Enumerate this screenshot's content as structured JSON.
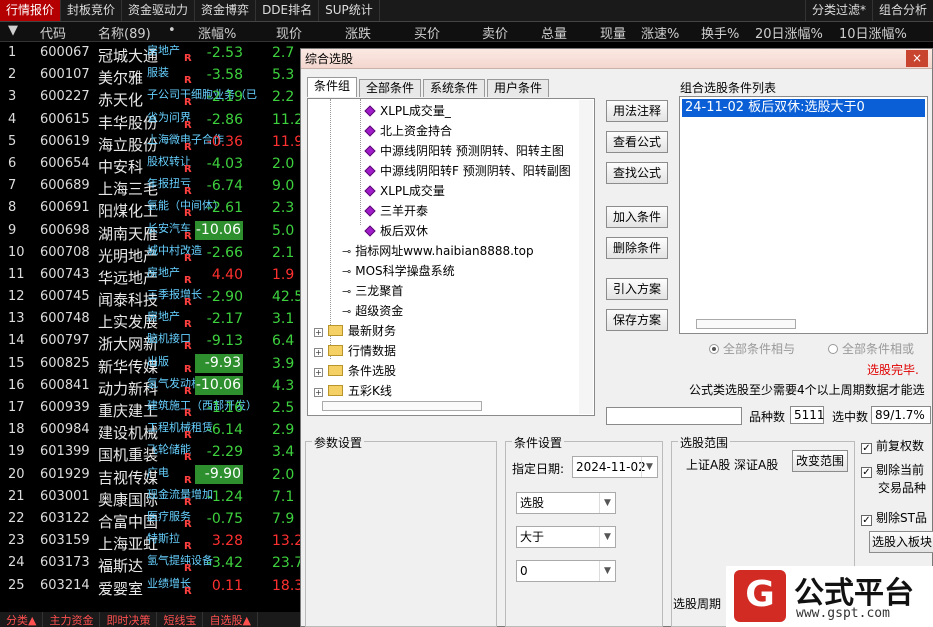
{
  "top_tabs": [
    "行情报价",
    "封板竞价",
    "资金驱动力",
    "资金博弈",
    "DDE排名",
    "SUP统计"
  ],
  "top_right": [
    "分类过滤*",
    "组合分析"
  ],
  "grid_headers": [
    "▼",
    "代码",
    "名称(89)",
    "•",
    "涨幅%",
    "现价",
    "涨跌",
    "买价",
    "卖价",
    "总量",
    "现量",
    "涨速%",
    "换手%",
    "20日涨幅%",
    "10日涨幅%"
  ],
  "rows": [
    {
      "idx": "1",
      "code": "600067",
      "name": "冠城大通",
      "tag": "房地产",
      "chg": "-2.53",
      "dir": "down",
      "price": "2.7"
    },
    {
      "idx": "2",
      "code": "600107",
      "name": "美尔雅",
      "tag": "服装",
      "chg": "-3.58",
      "dir": "down",
      "price": "5.3"
    },
    {
      "idx": "3",
      "code": "600227",
      "name": "赤天化",
      "tag": "子公司干细胞业务（已",
      "chg": "-2.19",
      "dir": "down",
      "price": "2.2"
    },
    {
      "idx": "4",
      "code": "600615",
      "name": "丰华股份",
      "tag": "省为问界",
      "chg": "-2.86",
      "dir": "down",
      "price": "11.2"
    },
    {
      "idx": "5",
      "code": "600619",
      "name": "海立股份",
      "tag": "上海微电子合作",
      "chg": "-0.36",
      "dir": "up",
      "price": "11.9"
    },
    {
      "idx": "6",
      "code": "600654",
      "name": "中安科",
      "tag": "股权转让",
      "chg": "-4.03",
      "dir": "down",
      "price": "2.0"
    },
    {
      "idx": "7",
      "code": "600689",
      "name": "上海三毛",
      "tag": "年报扭亏",
      "chg": "-6.74",
      "dir": "down",
      "price": "9.0"
    },
    {
      "idx": "8",
      "code": "600691",
      "name": "阳煤化工",
      "tag": "氢能（中间体）",
      "chg": "-2.61",
      "dir": "down",
      "price": "2.3"
    },
    {
      "idx": "9",
      "code": "600698",
      "name": "湖南天雁",
      "tag": "长安汽车",
      "chg": "-10.06",
      "dir": "limit",
      "price": "5.0"
    },
    {
      "idx": "10",
      "code": "600708",
      "name": "光明地产",
      "tag": "城中村改造",
      "chg": "-2.66",
      "dir": "down",
      "price": "2.1"
    },
    {
      "idx": "11",
      "code": "600743",
      "name": "华远地产",
      "tag": "房地产",
      "chg": "4.40",
      "dir": "up",
      "price": "1.9"
    },
    {
      "idx": "12",
      "code": "600745",
      "name": "闻泰科技",
      "tag": "三季报增长",
      "chg": "-2.90",
      "dir": "down",
      "price": "42.5"
    },
    {
      "idx": "13",
      "code": "600748",
      "name": "上实发展",
      "tag": "房地产",
      "chg": "-2.17",
      "dir": "down",
      "price": "3.1"
    },
    {
      "idx": "14",
      "code": "600797",
      "name": "浙大网新",
      "tag": "脑机接口",
      "chg": "-9.13",
      "dir": "down",
      "price": "6.4"
    },
    {
      "idx": "15",
      "code": "600825",
      "name": "新华传媒",
      "tag": "出版",
      "chg": "-9.93",
      "dir": "limit",
      "price": "3.9"
    },
    {
      "idx": "16",
      "code": "600841",
      "name": "动力新科",
      "tag": "氢气发动机",
      "chg": "-10.06",
      "dir": "limit",
      "price": "4.3"
    },
    {
      "idx": "17",
      "code": "600939",
      "name": "重庆建工",
      "tag": "建筑施工（西部开发）",
      "chg": "-1.16",
      "dir": "down",
      "price": "2.5"
    },
    {
      "idx": "18",
      "code": "600984",
      "name": "建设机械",
      "tag": "工程机械租赁",
      "chg": "-6.14",
      "dir": "down",
      "price": "2.9"
    },
    {
      "idx": "19",
      "code": "601399",
      "name": "国机重装",
      "tag": "飞轮储能",
      "chg": "-2.29",
      "dir": "down",
      "price": "3.4"
    },
    {
      "idx": "20",
      "code": "601929",
      "name": "吉视传媒",
      "tag": "广电",
      "chg": "-9.90",
      "dir": "limit",
      "price": "2.0"
    },
    {
      "idx": "21",
      "code": "603001",
      "name": "奥康国际",
      "tag": "现金流量增加",
      "chg": "-1.24",
      "dir": "down",
      "price": "7.1"
    },
    {
      "idx": "22",
      "code": "603122",
      "name": "合富中国",
      "tag": "医疗服务",
      "chg": "-0.75",
      "dir": "down",
      "price": "7.9"
    },
    {
      "idx": "23",
      "code": "603159",
      "name": "上海亚虹",
      "tag": "特斯拉",
      "chg": "3.28",
      "dir": "up",
      "price": "13.2"
    },
    {
      "idx": "24",
      "code": "603173",
      "name": "福斯达",
      "tag": "氢气提纯设备",
      "chg": "-3.42",
      "dir": "down",
      "price": "23.7"
    },
    {
      "idx": "25",
      "code": "603214",
      "name": "爱婴室",
      "tag": "业绩增长",
      "chg": "0.11",
      "dir": "up",
      "price": "18.3"
    }
  ],
  "bottom_tabs": [
    "分类▲",
    "主力资金",
    "即时决策",
    "短线宝",
    "自选股▲"
  ],
  "dialog": {
    "title": "综合选股",
    "close": "×",
    "tabs": [
      "条件组",
      "全部条件",
      "系统条件",
      "用户条件"
    ],
    "tree_leaf": [
      "XLPL成交量_",
      "北上资金持合",
      "中源线阴阳转 预测阴转、阳转主图",
      "中源线阴阳转F 预测阴转、阳转副图",
      "XLPL成交量",
      "三羊开泰",
      "板后双休"
    ],
    "tree_key": [
      "指标网址www.haibian8888.top",
      "MOS科学操盘系统",
      "三龙聚首",
      "超级资金"
    ],
    "tree_folder": [
      "最新财务",
      "行情数据",
      "条件选股",
      "五彩K线"
    ],
    "buttons_mid": [
      "用法注释",
      "查看公式",
      "查找公式",
      "加入条件",
      "删除条件",
      "引入方案",
      "保存方案"
    ],
    "list_title": "组合选股条件列表",
    "list_items": [
      "24-11-02 板后双休:选股大于0"
    ],
    "radio_and": "全部条件相与",
    "radio_or": "全部条件相或",
    "status": "选股完毕.",
    "hint": "公式类选股至少需要4个以上周期数据才能选",
    "count_label": "品种数",
    "count_value": "5111",
    "hit_label": "选中数",
    "hit_value": "89/1.7%",
    "param_title": "参数设置",
    "cond_title": "条件设置",
    "date_label": "指定日期:",
    "date_value": "2024-11-02",
    "combo1": "选股",
    "combo2": "大于",
    "combo3": "0",
    "range_title": "选股范围",
    "range_value": "上证A股 深证A股",
    "range_btn": "改变范围",
    "opt1": "前复权数",
    "opt2a": "剔除当前",
    "opt2b": "交易品种",
    "opt3": "剔除ST品",
    "board_btn": "选股入板块",
    "period_label": "选股周期",
    "logo_mark": "G",
    "logo_main": "公式平台",
    "logo_url": "www.gspt.com"
  }
}
